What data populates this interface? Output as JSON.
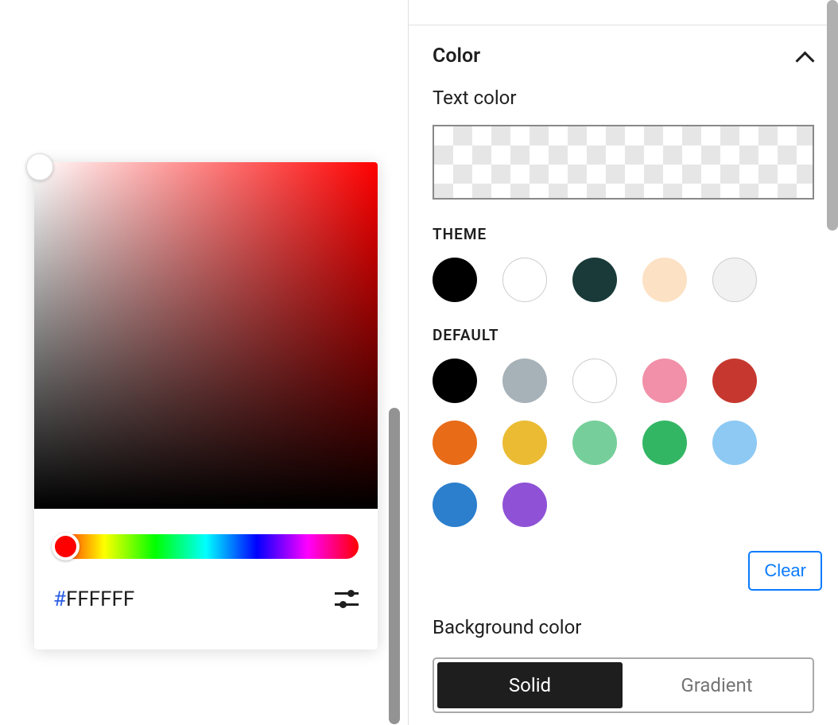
{
  "picker": {
    "hex_hash": "#",
    "hex_value": "FFFFFF"
  },
  "panel": {
    "title": "Color",
    "text_color_label": "Text color",
    "theme_label": "THEME",
    "default_label": "DEFAULT",
    "clear_label": "Clear",
    "background_label": "Background color",
    "tab_solid": "Solid",
    "tab_gradient": "Gradient",
    "theme_swatches": [
      {
        "color": "#000000",
        "bordered": false
      },
      {
        "color": "#ffffff",
        "bordered": true
      },
      {
        "color": "#1a3a3a",
        "bordered": false
      },
      {
        "color": "#fce1c4",
        "bordered": false
      },
      {
        "color": "#f1f1f1",
        "bordered": true
      }
    ],
    "default_swatches": [
      {
        "color": "#000000",
        "bordered": false
      },
      {
        "color": "#a7b1b8",
        "bordered": false
      },
      {
        "color": "#ffffff",
        "bordered": true
      },
      {
        "color": "#f190a8",
        "bordered": false
      },
      {
        "color": "#c6382f",
        "bordered": false
      },
      {
        "color": "#e86b17",
        "bordered": false
      },
      {
        "color": "#eabb33",
        "bordered": false
      },
      {
        "color": "#76cf9a",
        "bordered": false
      },
      {
        "color": "#33b664",
        "bordered": false
      },
      {
        "color": "#8dc9f3",
        "bordered": false
      },
      {
        "color": "#2b7fcc",
        "bordered": false
      },
      {
        "color": "#8f52d6",
        "bordered": false
      }
    ]
  }
}
